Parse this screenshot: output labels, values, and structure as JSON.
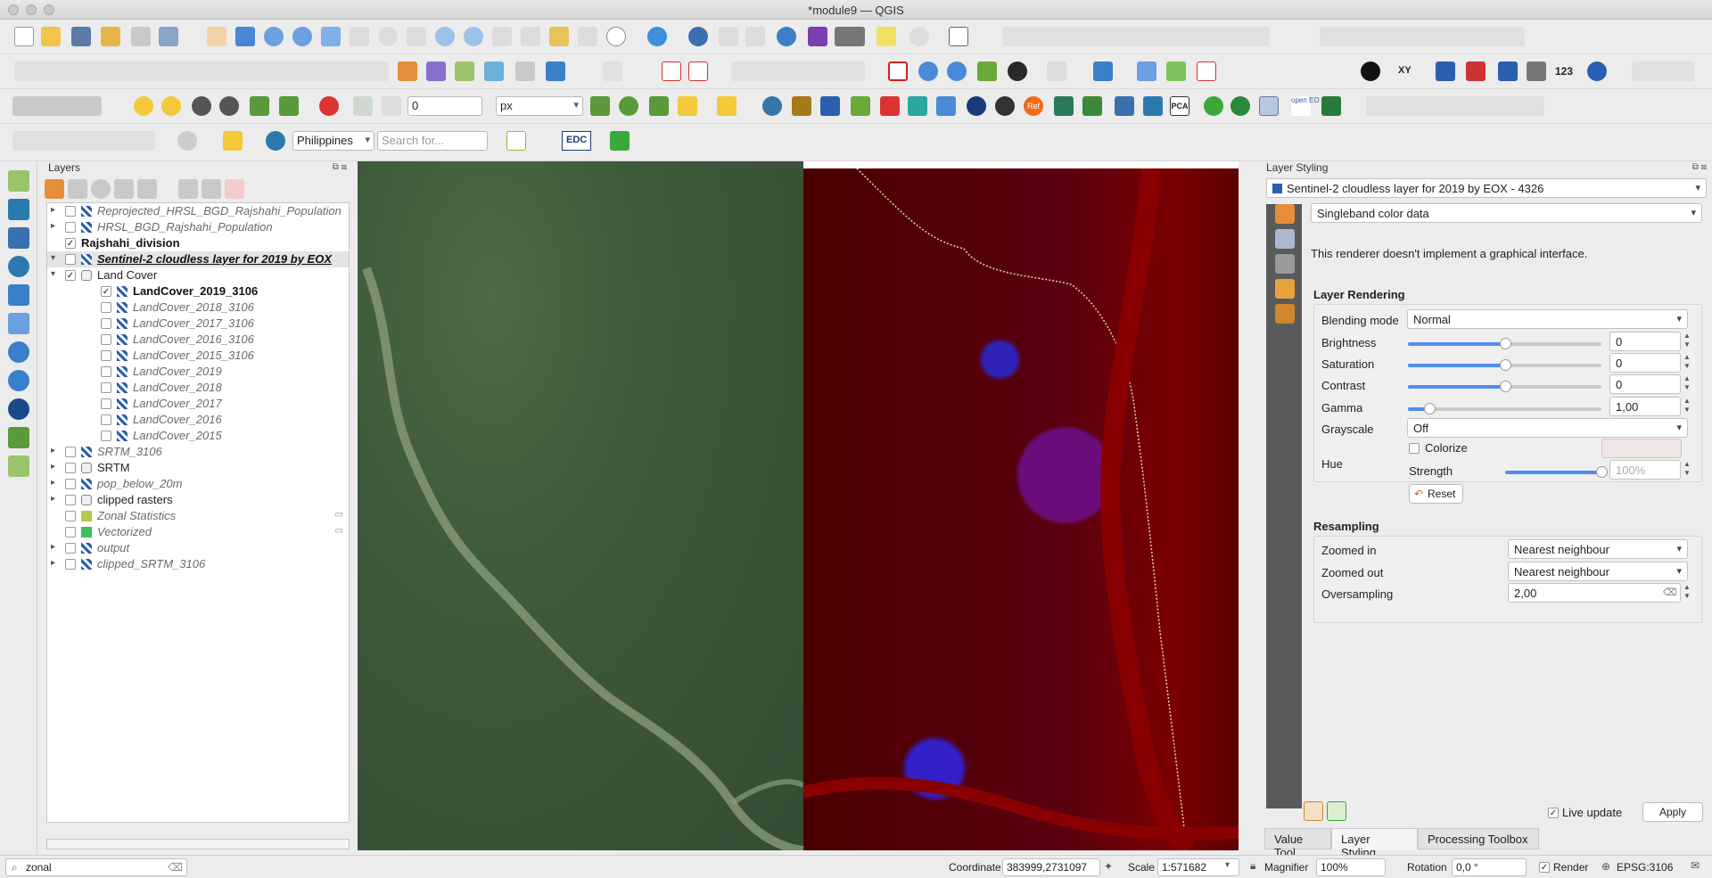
{
  "window": {
    "title": "*module9 — QGIS"
  },
  "toolbar": {
    "snap_tolerance_value": "0",
    "snap_unit": "px",
    "country_select": "Philippines",
    "search_placeholder": "Search for...",
    "edc_label": "EDC",
    "ref_label": "Ref",
    "pca_label": "PCA",
    "count_label": "123",
    "xy_label": "XY",
    "openeo_label": "open EO"
  },
  "layers_panel": {
    "title": "Layers",
    "layers": [
      {
        "name": "Reprojected_HRSL_BGD_Rajshahi_Population",
        "style": "italic",
        "checked": false,
        "expander": "▸",
        "indent": 0
      },
      {
        "name": "HRSL_BGD_Rajshahi_Population",
        "style": "italic",
        "checked": false,
        "expander": "▸",
        "indent": 0
      },
      {
        "name": "Rajshahi_division",
        "style": "bold",
        "checked": true,
        "expander": "",
        "indent": 0
      },
      {
        "name": "Sentinel-2 cloudless layer for 2019 by EOX",
        "style": "bold-italic-underline",
        "checked": false,
        "expander": "▾",
        "indent": 0,
        "selected": true
      },
      {
        "name": "Land Cover",
        "style": "normal",
        "checked": true,
        "expander": "▾",
        "indent": 0,
        "group": true
      },
      {
        "name": "LandCover_2019_3106",
        "style": "bold",
        "checked": true,
        "expander": "",
        "indent": 1
      },
      {
        "name": "LandCover_2018_3106",
        "style": "italic",
        "checked": false,
        "expander": "",
        "indent": 1
      },
      {
        "name": "LandCover_2017_3106",
        "style": "italic",
        "checked": false,
        "expander": "",
        "indent": 1
      },
      {
        "name": "LandCover_2016_3106",
        "style": "italic",
        "checked": false,
        "expander": "",
        "indent": 1
      },
      {
        "name": "LandCover_2015_3106",
        "style": "italic",
        "checked": false,
        "expander": "",
        "indent": 1
      },
      {
        "name": "LandCover_2019",
        "style": "italic",
        "checked": false,
        "expander": "",
        "indent": 1
      },
      {
        "name": "LandCover_2018",
        "style": "italic",
        "checked": false,
        "expander": "",
        "indent": 1
      },
      {
        "name": "LandCover_2017",
        "style": "italic",
        "checked": false,
        "expander": "",
        "indent": 1
      },
      {
        "name": "LandCover_2016",
        "style": "italic",
        "checked": false,
        "expander": "",
        "indent": 1
      },
      {
        "name": "LandCover_2015",
        "style": "italic",
        "checked": false,
        "expander": "",
        "indent": 1
      },
      {
        "name": "SRTM_3106",
        "style": "italic",
        "checked": false,
        "expander": "▸",
        "indent": 0
      },
      {
        "name": "SRTM",
        "style": "normal",
        "checked": false,
        "expander": "▸",
        "indent": 0,
        "group": true
      },
      {
        "name": "pop_below_20m",
        "style": "italic",
        "checked": false,
        "expander": "▸",
        "indent": 0
      },
      {
        "name": "clipped rasters",
        "style": "normal",
        "checked": false,
        "expander": "▸",
        "indent": 0,
        "group": true
      },
      {
        "name": "Zonal Statistics",
        "style": "italic",
        "checked": false,
        "expander": "",
        "indent": 0,
        "swatch": "#b5c94a"
      },
      {
        "name": "Vectorized",
        "style": "italic",
        "checked": false,
        "expander": "",
        "indent": 0,
        "swatch": "#3fbf5f"
      },
      {
        "name": "output",
        "style": "italic",
        "checked": false,
        "expander": "▸",
        "indent": 0
      },
      {
        "name": "clipped_SRTM_3106",
        "style": "italic",
        "checked": false,
        "expander": "▸",
        "indent": 0
      }
    ]
  },
  "styling_panel": {
    "title": "Layer Styling",
    "layer_select": "Sentinel-2 cloudless layer for 2019 by EOX - 4326",
    "renderer_select": "Singleband color data",
    "renderer_message": "This renderer doesn't implement a graphical interface.",
    "layer_rendering_title": "Layer Rendering",
    "blending_label": "Blending mode",
    "blending_value": "Normal",
    "brightness_label": "Brightness",
    "brightness_value": "0",
    "brightness_level": 0.5,
    "saturation_label": "Saturation",
    "saturation_value": "0",
    "saturation_level": 0.5,
    "contrast_label": "Contrast",
    "contrast_value": "0",
    "contrast_level": 0.5,
    "gamma_label": "Gamma",
    "gamma_value": "1,00",
    "gamma_level": 0.11,
    "grayscale_label": "Grayscale",
    "grayscale_value": "Off",
    "hue_label": "Hue",
    "colorize_label": "Colorize",
    "strength_label": "Strength",
    "strength_value": "100%",
    "strength_level": 1.0,
    "reset_label": "Reset",
    "resampling_title": "Resampling",
    "zoomed_in_label": "Zoomed in",
    "zoomed_in_value": "Nearest neighbour",
    "zoomed_out_label": "Zoomed out",
    "zoomed_out_value": "Nearest neighbour",
    "oversampling_label": "Oversampling",
    "oversampling_value": "2,00",
    "live_update_label": "Live update",
    "apply_label": "Apply",
    "tabs": [
      "Value Tool",
      "Layer Styling",
      "Processing Toolbox"
    ]
  },
  "statusbar": {
    "locator_value": "zonal",
    "coordinate_label": "Coordinate",
    "coordinate_value": "383999,2731097",
    "scale_label": "Scale",
    "scale_value": "1:571682",
    "magnifier_label": "Magnifier",
    "magnifier_value": "100%",
    "rotation_label": "Rotation",
    "rotation_value": "0,0 °",
    "render_label": "Render",
    "crs_label": "EPSG:3106"
  },
  "colors": {
    "accent": "#4d8ef0",
    "map_landcover_bg": "#5a0000",
    "map_built_up": "#3320c9"
  }
}
